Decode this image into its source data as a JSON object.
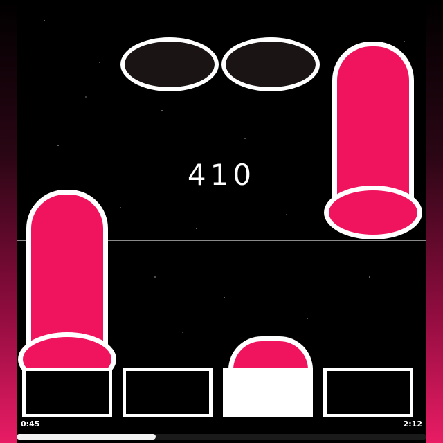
{
  "game": {
    "score": "410",
    "elapsed_time": "0:45",
    "total_time": "2:12",
    "progress_fraction": 0.34
  },
  "lanes": [
    {
      "name": "lane-1",
      "pressed": false
    },
    {
      "name": "lane-2",
      "pressed": false
    },
    {
      "name": "lane-3",
      "pressed": true
    },
    {
      "name": "lane-4",
      "pressed": false
    }
  ],
  "colors": {
    "note_pink": "#f0145f",
    "note_dark": "#1a1414",
    "outline": "#ffffff",
    "background": "#000000",
    "side_gradient_bottom": "#e91c64"
  }
}
